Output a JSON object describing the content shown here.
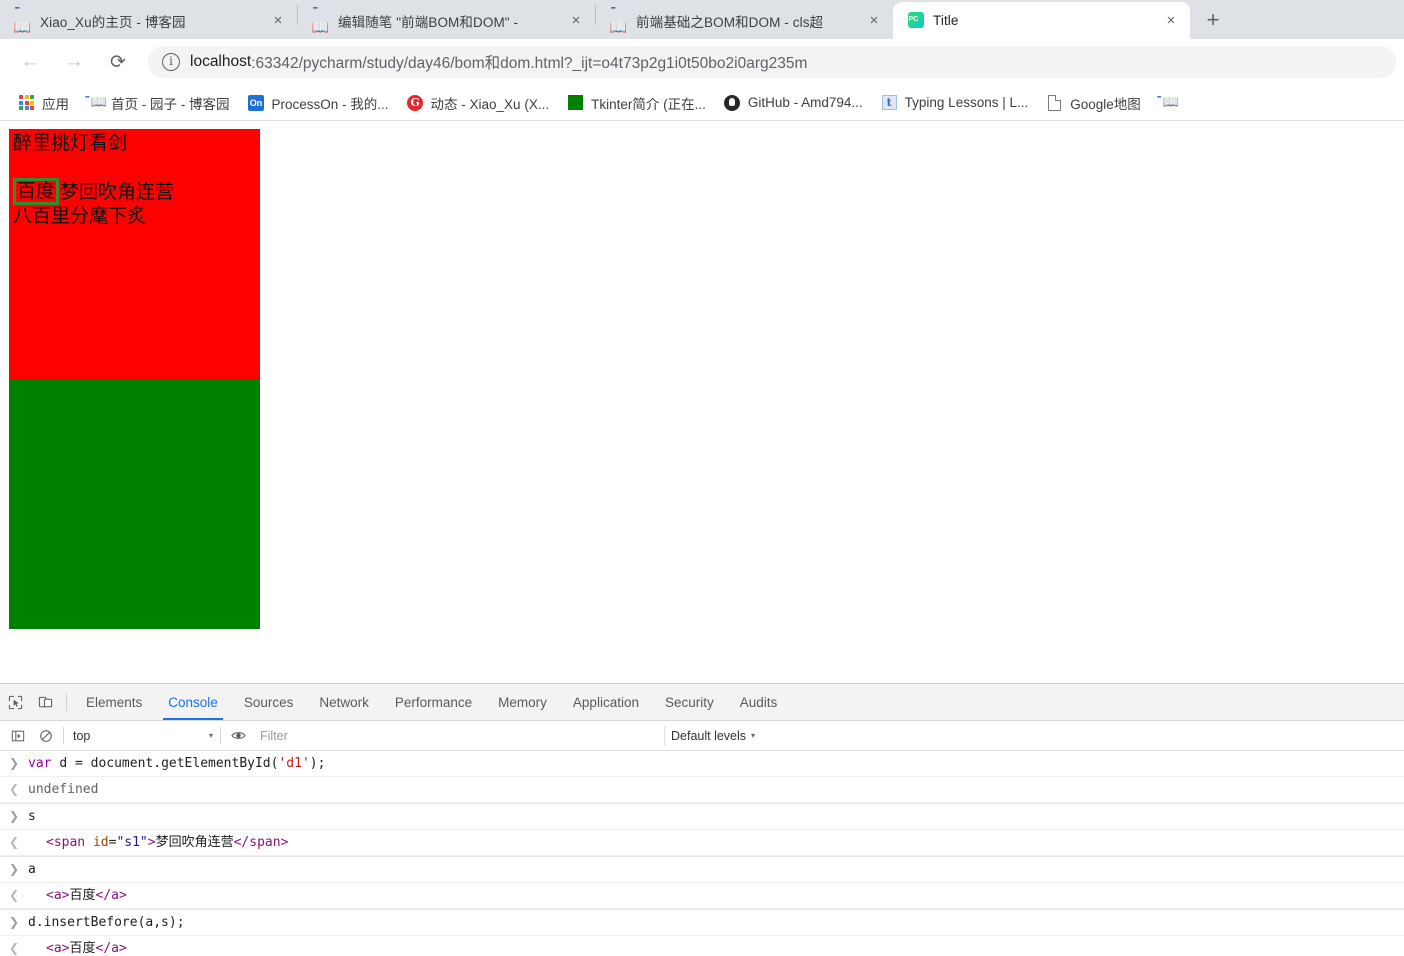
{
  "window": {
    "tabs": [
      {
        "title": "Xiao_Xu的主页 - 博客园",
        "favicon": "cnblogs-icon",
        "active": false,
        "close_label": "×"
      },
      {
        "title": "编辑随笔 \"前端BOM和DOM\" - ",
        "favicon": "cnblogs-icon",
        "active": false,
        "close_label": "×"
      },
      {
        "title": "前端基础之BOM和DOM - cls超",
        "favicon": "cnblogs-icon",
        "active": false,
        "close_label": "×"
      },
      {
        "title": "Title",
        "favicon": "pycharm-icon",
        "active": true,
        "close_label": "×"
      }
    ],
    "new_tab_label": "+"
  },
  "toolbar": {
    "back_label": "←",
    "forward_label": "→",
    "reload_label": "⟳",
    "info_label": "ⓘ",
    "url_host": "localhost",
    "url_rest": ":63342/pycharm/study/day46/bom和dom.html?_ijt=o4t73p2g1i0t50bo2i0arg235m",
    "url_full": "localhost:63342/pycharm/study/day46/bom和dom.html?_ijt=o4t73p2g1i0t50bo2i0arg235m"
  },
  "bookmarks": [
    {
      "label": "应用",
      "icon": "apps-grid-icon"
    },
    {
      "label": "首页 - 园子 - 博客园",
      "icon": "cnblogs-icon"
    },
    {
      "label": "ProcessOn - 我的...",
      "icon": "processon-icon"
    },
    {
      "label": "动态 - Xiao_Xu (X...",
      "icon": "cnblogs-g-icon"
    },
    {
      "label": "Tkinter简介 (正在...",
      "icon": "green-square-icon"
    },
    {
      "label": "GitHub - Amd794...",
      "icon": "github-icon"
    },
    {
      "label": "Typing Lessons | L...",
      "icon": "typing-icon"
    },
    {
      "label": "Google地图",
      "icon": "document-icon"
    },
    {
      "label": "",
      "icon": "cnblogs-icon"
    }
  ],
  "page": {
    "red_box_color": "#ff0000",
    "green_box_color": "#008000",
    "link_border_color": "#2f8f2f",
    "line1": "醉里挑灯看剑",
    "link_text": "百度",
    "line2_rest": "梦回吹角连营",
    "line3": "八百里分麾下炙"
  },
  "devtools": {
    "inspect_icon": "inspect-element-icon",
    "device_icon": "device-toolbar-icon",
    "tabs": [
      {
        "label": "Elements",
        "selected": false
      },
      {
        "label": "Console",
        "selected": true
      },
      {
        "label": "Sources",
        "selected": false
      },
      {
        "label": "Network",
        "selected": false
      },
      {
        "label": "Performance",
        "selected": false
      },
      {
        "label": "Memory",
        "selected": false
      },
      {
        "label": "Application",
        "selected": false
      },
      {
        "label": "Security",
        "selected": false
      },
      {
        "label": "Audits",
        "selected": false
      }
    ],
    "filterbar": {
      "sidebar_icon": "console-sidebar-icon",
      "clear_icon": "clear-console-icon",
      "context": "top",
      "context_caret": "▾",
      "eye_icon": "live-expression-icon",
      "filter_placeholder": "Filter",
      "filter_value": "",
      "levels_label": "Default levels",
      "levels_caret": "▾"
    },
    "console_rows": [
      {
        "kind": "input",
        "gutter": "❯",
        "text": "var d = document.getElementById('d1');"
      },
      {
        "kind": "output",
        "gutter": "❮",
        "text": "undefined"
      },
      {
        "kind": "input",
        "gutter": "❯",
        "text": "s"
      },
      {
        "kind": "output",
        "gutter": "❮",
        "text": "<span id=\"s1\">梦回吹角连营</span>"
      },
      {
        "kind": "input",
        "gutter": "❯",
        "text": "a"
      },
      {
        "kind": "output",
        "gutter": "❮",
        "text": "<a>百度</a>"
      },
      {
        "kind": "input",
        "gutter": "❯",
        "text": "d.insertBefore(a,s);"
      },
      {
        "kind": "output",
        "gutter": "❮",
        "text": "<a>百度</a>"
      }
    ]
  }
}
